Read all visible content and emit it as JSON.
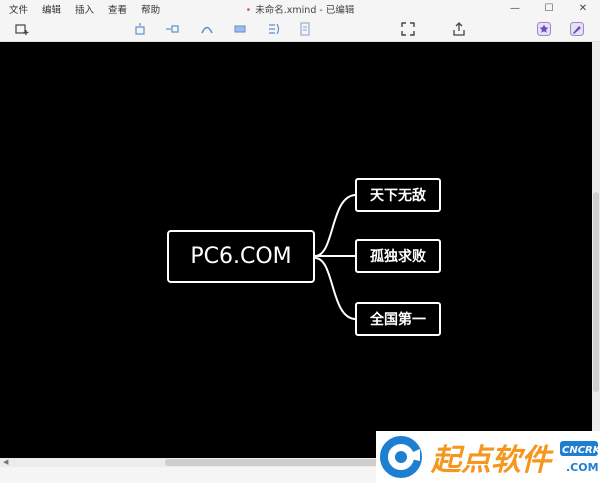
{
  "menu": [
    "文件",
    "编辑",
    "插入",
    "查看",
    "帮助"
  ],
  "window": {
    "title": "未命名.xmind - 已编辑",
    "unsaved_dot": "•",
    "minimize": "—",
    "maximize": "☐",
    "close": "✕"
  },
  "toolbar_icons": [
    "new-sheet-icon",
    "topic-icon",
    "subtopic-icon",
    "relationship-icon",
    "summary-icon",
    "boundary-icon",
    "note-icon",
    "fullscreen-icon",
    "share-icon",
    "pitch-icon",
    "theme-icon"
  ],
  "mindmap": {
    "central": "PC6.COM",
    "branches": [
      "天下无敌",
      "孤独求败",
      "全国第一"
    ]
  },
  "watermark": {
    "text": "起点软件",
    "badge": "CNCRK",
    "sub": ".COM"
  },
  "colors": {
    "canvas": "#000000",
    "node_border": "#ffffff",
    "watermark_orange": "#f5961e",
    "watermark_blue": "#1e7fd0"
  }
}
